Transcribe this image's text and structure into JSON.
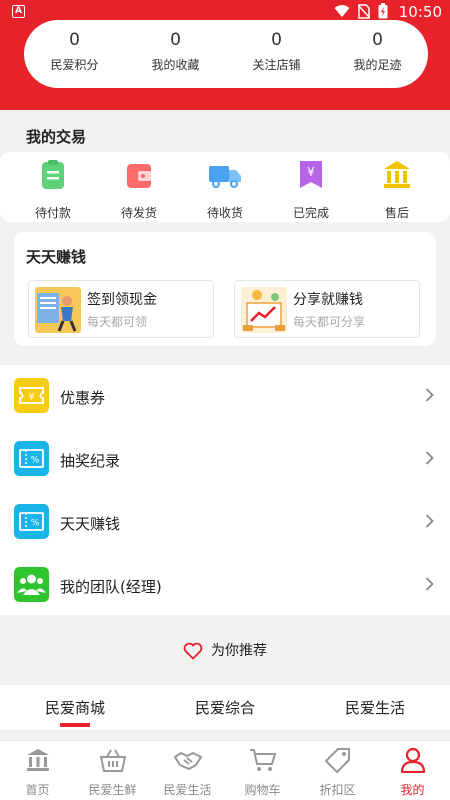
{
  "status_bar": {
    "app_badge": "A",
    "time": "10:50"
  },
  "stats": [
    {
      "value": "0",
      "label": "民爱积分"
    },
    {
      "value": "0",
      "label": "我的收藏"
    },
    {
      "value": "0",
      "label": "关注店铺"
    },
    {
      "value": "0",
      "label": "我的足迹"
    }
  ],
  "trade": {
    "title": "我的交易",
    "items": [
      {
        "label": "待付款",
        "icon": "clipboard-icon",
        "color": "#5fd17a"
      },
      {
        "label": "待发货",
        "icon": "wallet-icon",
        "color": "#ff6b6b"
      },
      {
        "label": "待收货",
        "icon": "truck-icon",
        "color": "#4aa3f0"
      },
      {
        "label": "已完成",
        "icon": "yuan-tag-icon",
        "color": "#b665e8"
      },
      {
        "label": "售后",
        "icon": "bank-icon",
        "color": "#f5c400"
      }
    ]
  },
  "earn": {
    "title": "天天赚钱",
    "cards": [
      {
        "title": "签到领现金",
        "subtitle": "每天都可领"
      },
      {
        "title": "分享就赚钱",
        "subtitle": "每天都可分享"
      }
    ]
  },
  "menu": [
    {
      "label": "优惠券",
      "icon": "coupon-icon",
      "color": "#f7cc14"
    },
    {
      "label": "抽奖纪录",
      "icon": "percent-ticket-icon",
      "color": "#19b4e8"
    },
    {
      "label": "天天赚钱",
      "icon": "percent-ticket-icon",
      "color": "#19b4e8"
    },
    {
      "label": "我的团队(经理)",
      "icon": "team-icon",
      "color": "#2ec42e"
    }
  ],
  "recommend": {
    "label": "为你推荐"
  },
  "tabs": [
    {
      "label": "民爱商城",
      "active": true
    },
    {
      "label": "民爱综合",
      "active": false
    },
    {
      "label": "民爱生活",
      "active": false
    }
  ],
  "bottom_nav": [
    {
      "label": "首页",
      "icon": "bank-icon"
    },
    {
      "label": "民爱生鲜",
      "icon": "basket-icon"
    },
    {
      "label": "民爱生活",
      "icon": "handshake-icon"
    },
    {
      "label": "购物车",
      "icon": "cart-icon"
    },
    {
      "label": "折扣区",
      "icon": "tag-icon"
    },
    {
      "label": "我的",
      "icon": "user-icon",
      "active": true
    }
  ],
  "colors": {
    "brand": "#e8222a",
    "nav_inactive": "#888888"
  }
}
